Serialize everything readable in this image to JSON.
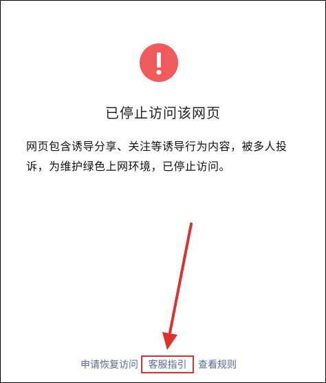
{
  "alert": {
    "icon": "exclamation-icon",
    "icon_color": "#f05a5a",
    "title": "已停止访问该网页",
    "description": "网页包含诱导分享、关注等诱导行为内容，被多人投诉，为维护绿色上网环境，已停止访问。"
  },
  "footer": {
    "restore_label": "申请恢复访问",
    "service_label": "客服指引",
    "rules_label": "查看规则",
    "link_color": "#576b95",
    "highlight_color": "#e0302c"
  }
}
